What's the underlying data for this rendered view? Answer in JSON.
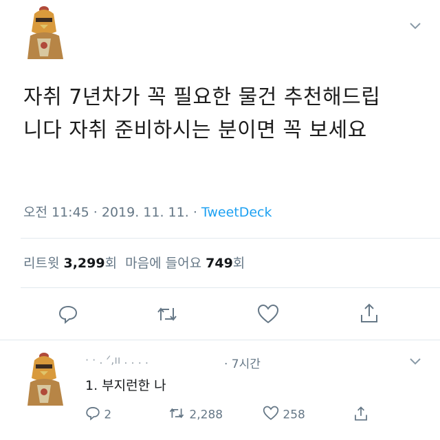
{
  "tweet": {
    "text_line1": "자취 7년차가 꼭 필요한 물건 추천해드립",
    "text_line2": "니다 자취 준비하시는 분이면 꼭 보세요",
    "time_date": "오전 11:45 · 2019. 11. 11. · ",
    "source": "TweetDeck",
    "retweet_label": "리트윗 ",
    "retweet_count": "3,299",
    "retweet_unit": "회",
    "like_label": "  마음에 들어요 ",
    "like_count": "749",
    "like_unit": "회",
    "actions": [
      "reply-icon",
      "retweet-icon",
      "heart-icon",
      "share-icon"
    ]
  },
  "reply": {
    "name": "· ·  . ᐟ,ıı . . . .",
    "time": "· 7시간",
    "text": "1. 부지런한 나",
    "reply_count": "2",
    "retweet_count": "2,288",
    "like_count": "258"
  },
  "colors": {
    "accent": "#1da1f2",
    "muted": "#657786",
    "divider": "#e1e8ed"
  }
}
